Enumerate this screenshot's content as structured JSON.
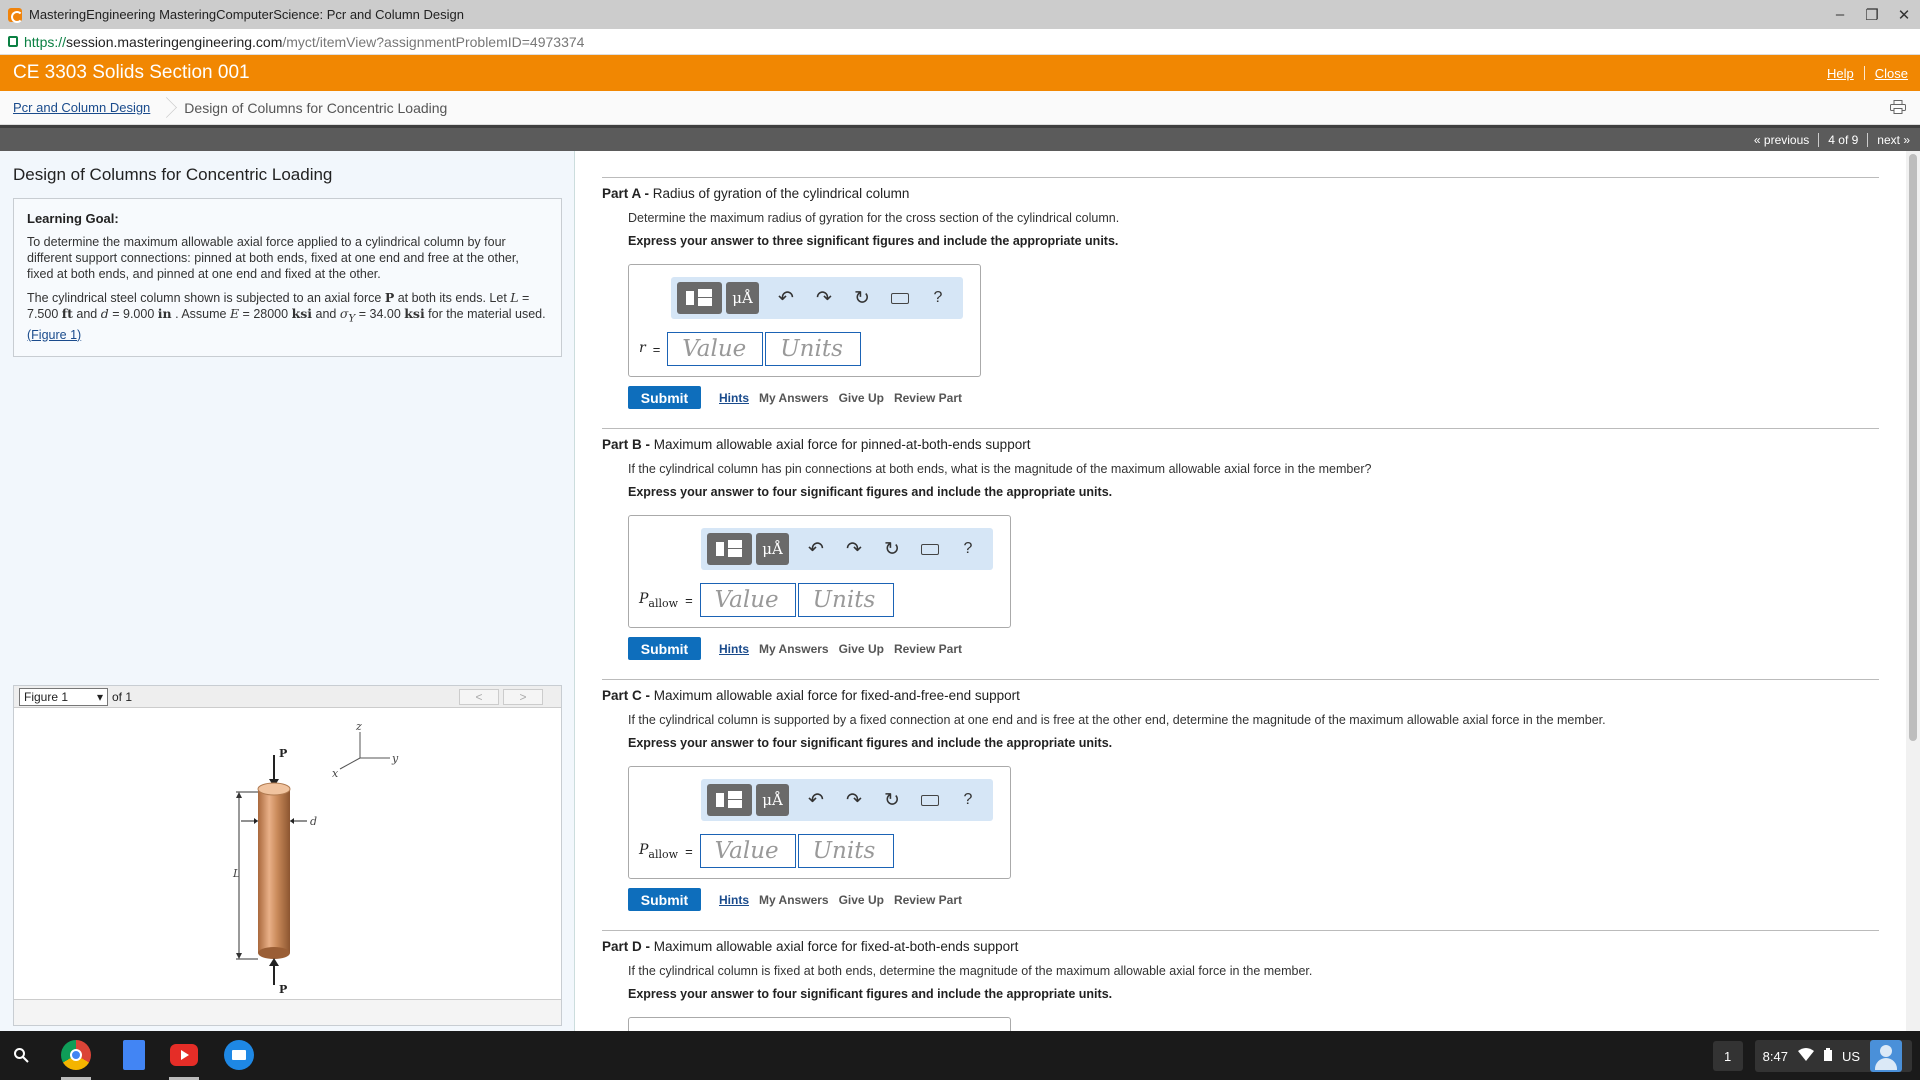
{
  "window": {
    "title": "MasteringEngineering MasteringComputerScience: Pcr and Column Design",
    "url_scheme": "https://",
    "url_host": "session.masteringengineering.com",
    "url_path": "/myct/itemView?assignmentProblemID=4973374"
  },
  "header": {
    "course": "CE 3303 Solids Section 001",
    "help": "Help",
    "close": "Close"
  },
  "breadcrumb": {
    "assignment": "Pcr and Column Design",
    "current": "Design of Columns for Concentric Loading"
  },
  "nav": {
    "previous": "« previous",
    "position": "4 of 9",
    "next": "next »"
  },
  "left": {
    "title": "Design of Columns for Concentric Loading",
    "goal_heading": "Learning Goal:",
    "goal_text": "To determine the maximum allowable axial force applied to a cylindrical column by four different support connections: pinned at both ends, fixed at one end and free at the other, fixed at both ends, and pinned at one end and fixed at the other.",
    "intro": {
      "t1": "The cylindrical steel column shown is subjected to an axial force ",
      "P": "P",
      "t2": " at both its ends. Let ",
      "L": "L",
      "t3": " = 7.500 ",
      "ft": "ft",
      "t4": " and ",
      "d": "d",
      "t5": " = 9.000 ",
      "in": "in",
      "t6": " . Assume ",
      "E": "E",
      "t7": " = 28000 ",
      "ksi1": "ksi",
      "t8": " and ",
      "sigma": "σ",
      "Y": "Y",
      "t9": " = 34.00 ",
      "ksi2": "ksi",
      "t10": " for the material used.",
      "fig_link": "(Figure 1)"
    },
    "figure": {
      "selected": "Figure 1",
      "of": "of 1",
      "prev": "<",
      "next": ">",
      "labels": {
        "P_top": "P",
        "P_bottom": "P",
        "z": "z",
        "y": "y",
        "x": "x",
        "d": "d",
        "L": "L"
      }
    }
  },
  "parts": [
    {
      "label": "Part A - ",
      "title": "Radius of gyration of the cylindrical column",
      "question": "Determine the maximum radius of gyration for the cross section of the cylindrical column.",
      "express": "Express your answer to three significant figures and include the appropriate units.",
      "var": "r",
      "sub": "",
      "eq": "=",
      "value_placeholder": "Value",
      "units_placeholder": "Units"
    },
    {
      "label": "Part B - ",
      "title": "Maximum allowable axial force for pinned-at-both-ends support",
      "question": "If the cylindrical column has pin connections at both ends, what is the magnitude of the maximum allowable axial force in the member?",
      "express": "Express your answer to four significant figures and include the appropriate units.",
      "var": "P",
      "sub": "allow",
      "eq": "=",
      "value_placeholder": "Value",
      "units_placeholder": "Units"
    },
    {
      "label": "Part C - ",
      "title": "Maximum allowable axial force for fixed-and-free-end support",
      "question": "If the cylindrical column is supported by a fixed connection at one end and is free at the other end, determine the magnitude of the maximum allowable axial force in the member.",
      "express": "Express your answer to four significant figures and include the appropriate units.",
      "var": "P",
      "sub": "allow",
      "eq": "=",
      "value_placeholder": "Value",
      "units_placeholder": "Units"
    },
    {
      "label": "Part D - ",
      "title": "Maximum allowable axial force for fixed-at-both-ends support",
      "question": "If the cylindrical column is fixed at both ends, determine the magnitude of the maximum allowable axial force in the member.",
      "express": "Express your answer to four significant figures and include the appropriate units."
    }
  ],
  "toolbar": {
    "units_label": "μÅ",
    "undo": "↶",
    "redo": "↷",
    "reset": "↻",
    "help": "?"
  },
  "actions": {
    "submit": "Submit",
    "hints": "Hints",
    "my_answers": "My Answers",
    "give_up": "Give Up",
    "review_part": "Review Part"
  },
  "taskbar": {
    "badge": "1",
    "time": "8:47",
    "locale": "US"
  },
  "colors": {
    "orange": "#f18702",
    "link": "#1a4b8c",
    "submit": "#0e6ebc",
    "toolbar": "#d6e6f6"
  }
}
